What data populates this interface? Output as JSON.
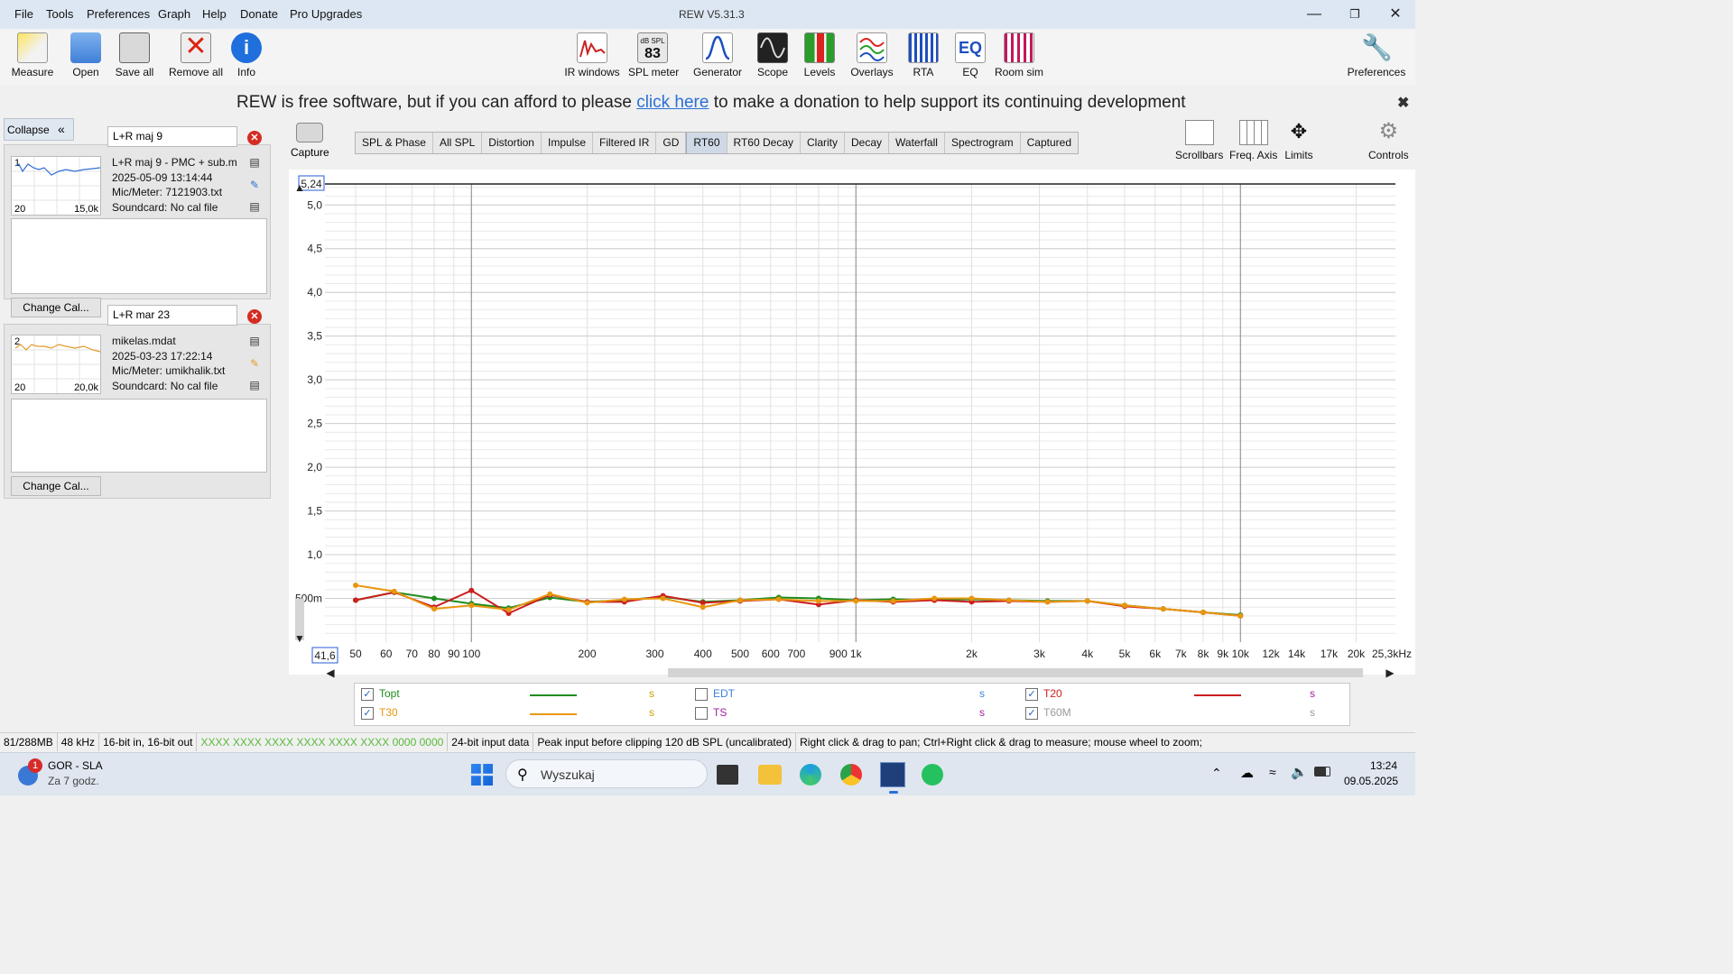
{
  "window": {
    "title": "REW V5.31.3",
    "menu": [
      "File",
      "Tools",
      "Preferences",
      "Graph",
      "Help",
      "Donate",
      "Pro Upgrades"
    ]
  },
  "toolbar": {
    "left": [
      {
        "label": "Measure",
        "icon": "measure-icon"
      },
      {
        "label": "Open",
        "icon": "folder-icon"
      },
      {
        "label": "Save all",
        "icon": "save-icon"
      },
      {
        "label": "Remove all",
        "icon": "remove-icon"
      },
      {
        "label": "Info",
        "icon": "info-icon"
      }
    ],
    "center": [
      {
        "label": "IR windows",
        "icon": "ir-windows-icon"
      },
      {
        "label": "SPL meter",
        "icon": "spl-meter-icon",
        "badge_top": "dB SPL",
        "badge_value": "83"
      },
      {
        "label": "Generator",
        "icon": "generator-icon"
      },
      {
        "label": "Scope",
        "icon": "scope-icon"
      },
      {
        "label": "Levels",
        "icon": "levels-icon"
      },
      {
        "label": "Overlays",
        "icon": "overlays-icon"
      },
      {
        "label": "RTA",
        "icon": "rta-icon"
      },
      {
        "label": "EQ",
        "icon": "eq-icon"
      },
      {
        "label": "Room sim",
        "icon": "room-sim-icon"
      }
    ],
    "preferences_label": "Preferences"
  },
  "donation": {
    "before": "REW is free software, but if you can afford to please ",
    "link": "click here",
    "after": " to make a donation to help support its continuing development"
  },
  "left_panel": {
    "collapse_label": "Collapse",
    "collapse_icon": "double-chevron-left-icon",
    "measurements": [
      {
        "name": "L+R maj 9",
        "number": "1",
        "file": "L+R maj 9 - PMC + sub.m",
        "date": "2025-05-09 13:14:44",
        "mic": "Mic/Meter: 7121903.txt",
        "soundcard": "Soundcard: No cal file",
        "range_lo": "20",
        "range_hi": "15,0k",
        "color": "#2f6fd6",
        "change_cal": "Change Cal..."
      },
      {
        "name": "L+R mar 23",
        "number": "2",
        "file": "mikelas.mdat",
        "date": "2025-03-23 17:22:14",
        "mic": "Mic/Meter: umikhalik.txt",
        "soundcard": "Soundcard: No cal file",
        "range_lo": "20",
        "range_hi": "20,0k",
        "color": "#e59a2a",
        "change_cal": "Change Cal..."
      }
    ]
  },
  "graph_tabs": {
    "capture_label": "Capture",
    "tabs": [
      "SPL & Phase",
      "All SPL",
      "Distortion",
      "Impulse",
      "Filtered IR",
      "GD",
      "RT60",
      "RT60 Decay",
      "Clarity",
      "Decay",
      "Waterfall",
      "Spectrogram",
      "Captured"
    ],
    "active": "RT60",
    "right_tools": [
      "Scrollbars",
      "Freq. Axis",
      "Limits",
      "Controls"
    ]
  },
  "chart_data": {
    "type": "line",
    "title": "",
    "xlabel": "",
    "ylabel": "",
    "x_scale": "log",
    "xlim": [
      41.6,
      25300
    ],
    "ylim": [
      0,
      5.24
    ],
    "y_top_box": "5,24",
    "x_left_box": "41,6",
    "y_ticks": [
      {
        "v": 5.0,
        "label": "5,0"
      },
      {
        "v": 4.5,
        "label": "4,5"
      },
      {
        "v": 4.0,
        "label": "4,0"
      },
      {
        "v": 3.5,
        "label": "3,5"
      },
      {
        "v": 3.0,
        "label": "3,0"
      },
      {
        "v": 2.5,
        "label": "2,5"
      },
      {
        "v": 2.0,
        "label": "2,0"
      },
      {
        "v": 1.5,
        "label": "1,5"
      },
      {
        "v": 1.0,
        "label": "1,0"
      },
      {
        "v": 0.5,
        "label": "500m"
      }
    ],
    "x_ticks": [
      {
        "v": 50,
        "label": "50"
      },
      {
        "v": 60,
        "label": "60"
      },
      {
        "v": 70,
        "label": "70"
      },
      {
        "v": 80,
        "label": "80"
      },
      {
        "v": 90,
        "label": "90"
      },
      {
        "v": 100,
        "label": "100"
      },
      {
        "v": 200,
        "label": "200"
      },
      {
        "v": 300,
        "label": "300"
      },
      {
        "v": 400,
        "label": "400"
      },
      {
        "v": 500,
        "label": "500"
      },
      {
        "v": 600,
        "label": "600"
      },
      {
        "v": 700,
        "label": "700"
      },
      {
        "v": 900,
        "label": "900"
      },
      {
        "v": 1000,
        "label": "1k"
      },
      {
        "v": 2000,
        "label": "2k"
      },
      {
        "v": 3000,
        "label": "3k"
      },
      {
        "v": 4000,
        "label": "4k"
      },
      {
        "v": 5000,
        "label": "5k"
      },
      {
        "v": 6000,
        "label": "6k"
      },
      {
        "v": 7000,
        "label": "7k"
      },
      {
        "v": 8000,
        "label": "8k"
      },
      {
        "v": 9000,
        "label": "9k"
      },
      {
        "v": 10000,
        "label": "10k"
      },
      {
        "v": 12000,
        "label": "12k"
      },
      {
        "v": 14000,
        "label": "14k"
      },
      {
        "v": 17000,
        "label": "17k"
      },
      {
        "v": 20000,
        "label": "20k"
      },
      {
        "v": 25300,
        "label": "25,3kHz"
      }
    ],
    "x": [
      50,
      63,
      80,
      100,
      125,
      160,
      200,
      250,
      315,
      400,
      500,
      630,
      800,
      1000,
      1250,
      1600,
      2000,
      2500,
      3150,
      4000,
      5000,
      6300,
      8000,
      10000
    ],
    "series": [
      {
        "name": "Topt",
        "color": "#1e8c1e",
        "values": [
          0.48,
          0.57,
          0.5,
          0.44,
          0.39,
          0.51,
          0.46,
          0.48,
          0.52,
          0.46,
          0.48,
          0.51,
          0.5,
          0.48,
          0.49,
          0.48,
          0.49,
          0.48,
          0.47,
          0.47,
          0.42,
          0.38,
          0.34,
          0.31
        ]
      },
      {
        "name": "T20",
        "color": "#cc1f1f",
        "values": [
          0.48,
          0.57,
          0.4,
          0.59,
          0.33,
          0.54,
          0.46,
          0.46,
          0.53,
          0.45,
          0.47,
          0.49,
          0.43,
          0.48,
          0.46,
          0.48,
          0.46,
          0.47,
          0.46,
          0.47,
          0.41,
          0.38,
          0.34,
          0.3
        ]
      },
      {
        "name": "T30",
        "color": "#e8960e",
        "values": [
          0.65,
          0.58,
          0.38,
          0.42,
          0.37,
          0.55,
          0.45,
          0.49,
          0.5,
          0.4,
          0.48,
          0.49,
          0.47,
          0.47,
          0.47,
          0.5,
          0.5,
          0.48,
          0.46,
          0.47,
          0.42,
          0.38,
          0.34,
          0.3
        ]
      }
    ]
  },
  "legend": {
    "items": [
      {
        "name": "Topt",
        "checked": true,
        "color": "#1e8c1e",
        "unit": "s",
        "unit_color": "#c8a000"
      },
      {
        "name": "EDT",
        "checked": false,
        "color": "#3d7fe0",
        "unit": "s",
        "unit_color": "#3d7fe0"
      },
      {
        "name": "T20",
        "checked": true,
        "color": "#cc1f1f",
        "unit": "s",
        "unit_color": "#a020a0"
      },
      {
        "name": "T30",
        "checked": true,
        "color": "#e8960e",
        "unit": "s",
        "unit_color": "#c8a000"
      },
      {
        "name": "TS",
        "checked": false,
        "color": "#a020a0",
        "unit": "s",
        "unit_color": "#a020a0"
      },
      {
        "name": "T60M",
        "checked": true,
        "color": "#9a9a9a",
        "unit": "s",
        "unit_color": "#9a9a9a"
      }
    ]
  },
  "status_bar": {
    "memory": "81/288MB",
    "rate": "48 kHz",
    "bits": "16-bit in, 16-bit out",
    "meters": "XXXX XXXX  XXXX XXXX  XXXX XXXX  0000 0000",
    "input": "24-bit input data",
    "peak": "Peak input before clipping 120 dB SPL (uncalibrated)",
    "hint": "Right click & drag to pan; Ctrl+Right click & drag to measure; mouse wheel to zoom;"
  },
  "taskbar": {
    "weather_title": "GOR - SLA",
    "weather_sub": "Za 7 godz.",
    "notif_count": "1",
    "search_placeholder": "Wyszukaj",
    "time": "13:24",
    "date": "09.05.2025"
  }
}
